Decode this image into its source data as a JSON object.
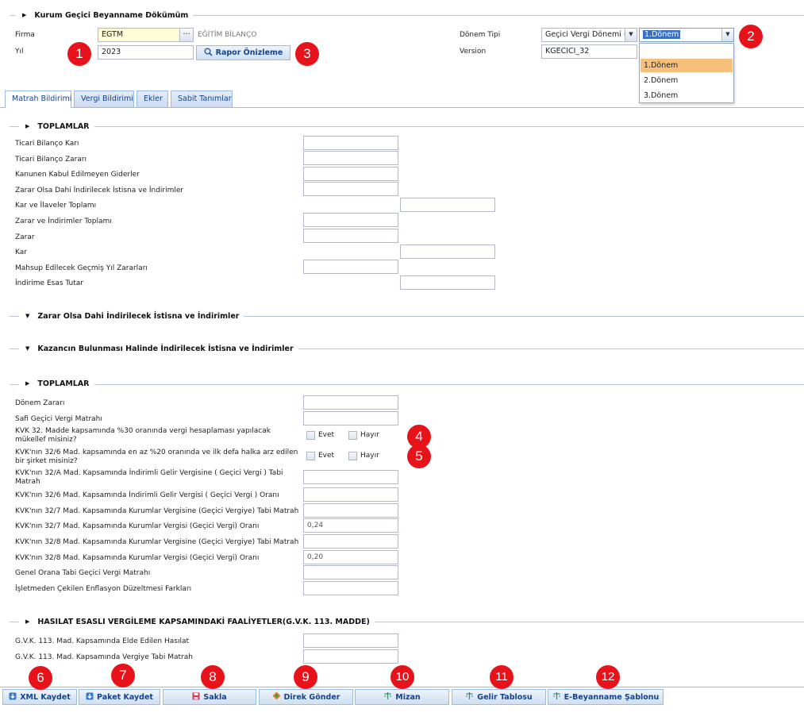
{
  "header": {
    "title": "Kurum Geçici Beyanname Dökümüm"
  },
  "form": {
    "firma_label": "Firma",
    "firma_value": "EGTM",
    "firma_lookup": "···",
    "firma_name": "EĞİTİM BİLANÇO",
    "yil_label": "Yıl",
    "yil_value": "2023",
    "rapor_button": "Rapor Önizleme",
    "donem_tipi_label": "Dönem Tipi",
    "donem_tipi_value": "Geçici Vergi Dönemi (",
    "donem_value": "1.Dönem",
    "version_label": "Version",
    "version_value": "KGECICI_32",
    "donem_options": [
      "1.Dönem",
      "2.Dönem",
      "3.Dönem"
    ]
  },
  "tabs": [
    "Matrah Bildirimi",
    "Vergi Bildirimi",
    "Ekler",
    "Sabit Tanımlar"
  ],
  "sections": {
    "toplamlar1": "TOPLAMLAR",
    "zarar_olsa": "Zarar Olsa Dahi İndirilecek İstisna ve İndirimler",
    "kazancin": "Kazancın Bulunması Halinde İndirilecek İstisna ve İndirimler",
    "toplamlar2": "TOPLAMLAR",
    "hasilat": "HASILAT ESASLI VERGİLEME KAPSAMINDAKİ FAALİYETLER(G.V.K. 113. MADDE)"
  },
  "toplamlar1_rows": [
    "Ticari Bilanço Karı",
    "Ticari Bilanço Zararı",
    "Kanunen Kabul Edilmeyen Giderler",
    "Zarar Olsa Dahi İndirilecek İstisna ve İndirimler",
    "Kar ve İlaveler Toplamı",
    "Zarar ve İndirimler Toplamı",
    "Zarar",
    "Kar",
    "Mahsup Edilecek Geçmiş Yıl Zararları",
    "İndirime Esas Tutar"
  ],
  "toplamlar2_rows": {
    "donem_zarari": "Dönem Zararı",
    "safi": "Safi Geçici Vergi Matrahı",
    "kvk32": "KVK 32. Madde kapsamında %30 oranında vergi hesaplaması yapılacak mükellef misiniz?",
    "kvk326": "KVK'nın 32/6 Mad. kapsamında en az %20 oranında ve ilk defa halka arz edilen bir şirket misiniz?",
    "kvk32a": "KVK'nın 32/A Mad. Kapsamında İndirimli Gelir Vergisine ( Geçici Vergi ) Tabi Matrah",
    "kvk326_oran": "KVK'nın 32/6 Mad. Kapsamında İndirimli Gelir Vergisi ( Geçici Vergi ) Oranı",
    "kvk327_matrah": "KVK'nın 32/7 Mad. Kapsamında Kurumlar Vergisine (Geçici Vergiye) Tabi Matrah",
    "kvk327_oran": "KVK'nın 32/7 Mad. Kapsamında Kurumlar Vergisi (Geçici Vergi) Oranı",
    "kvk328_matrah": "KVK'nın 32/8 Mad. Kapsamında Kurumlar Vergisine (Geçici Vergiye) Tabi Matrah",
    "kvk328_oran": "KVK'nın 32/8 Mad. Kapsamında Kurumlar Vergisi (Geçici Vergi) Oranı",
    "genel": "Genel Orana Tabi Geçici Vergi Matrahı",
    "enflasyon": "İşletmeden Çekilen Enflasyon Düzeltmesi Farkları",
    "oran_327_value": "0,24",
    "oran_328_value": "0,20",
    "evet": "Evet",
    "hayir": "Hayır"
  },
  "hasilat_rows": [
    "G.V.K. 113. Mad. Kapsamında Elde Edilen Hasılat",
    "G.V.K. 113. Mad. Kapsamında Vergiye Tabi Matrah"
  ],
  "buttons": [
    "XML Kaydet",
    "Paket Kaydet",
    "Sakla",
    "Direk Gönder",
    "Mizan",
    "Gelir Tablosu",
    "E-Beyanname Şablonu"
  ],
  "badges": [
    "1",
    "2",
    "3",
    "4",
    "5",
    "6",
    "7",
    "8",
    "9",
    "10",
    "11",
    "12"
  ],
  "colors": {
    "badge": "#e8121b",
    "accent": "#15428b",
    "required": "#e0304a",
    "highlight": "#f7c07a"
  }
}
